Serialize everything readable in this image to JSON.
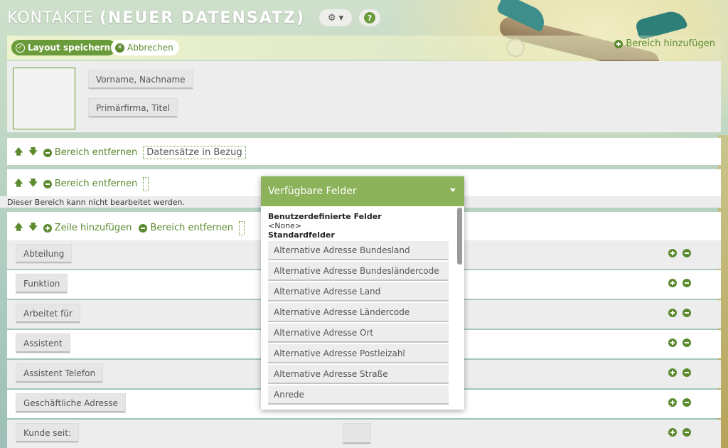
{
  "header": {
    "title": "KONTAKTE",
    "subtitle": "(NEUER DATENSATZ)",
    "gear_glyph": "⚙ ▾",
    "help_glyph": "?"
  },
  "toolbar": {
    "save_label": "Layout speichern",
    "cancel_label": "Abbrechen",
    "add_area_label": "Bereich hinzufügen"
  },
  "head": {
    "name_field": "Vorname, Nachname",
    "company_field": "Primärfirma, Titel"
  },
  "sections": {
    "remove_label": "Bereich entfernen",
    "related_label": "Datensätze in Bezug",
    "readonly_note": "Dieser Bereich kann nicht bearbeitet werden.",
    "add_row_label": "Zeile hinzufügen"
  },
  "fields": [
    {
      "label": "Abteilung"
    },
    {
      "label": "Funktion"
    },
    {
      "label": "Arbeitet für"
    },
    {
      "label": "Assistent"
    },
    {
      "label": "Assistent Telefon"
    },
    {
      "label": "Geschäftliche Adresse"
    },
    {
      "label": "Kunde seit:"
    }
  ],
  "dropdown": {
    "title": "Verfügbare Felder",
    "custom_heading": "Benutzerdefinierte Felder",
    "none_label": "<None>",
    "standard_heading": "Standardfelder",
    "items": [
      "Alternative Adresse Bundesland",
      "Alternative Adresse Bundesländercode",
      "Alternative Adresse Land",
      "Alternative Adresse Ländercode",
      "Alternative Adresse Ort",
      "Alternative Adresse Postleizahl",
      "Alternative Adresse Straße",
      "Anrede"
    ]
  },
  "colors": {
    "accent": "#6a9b3a",
    "dropdown_header": "#8cb25a"
  }
}
